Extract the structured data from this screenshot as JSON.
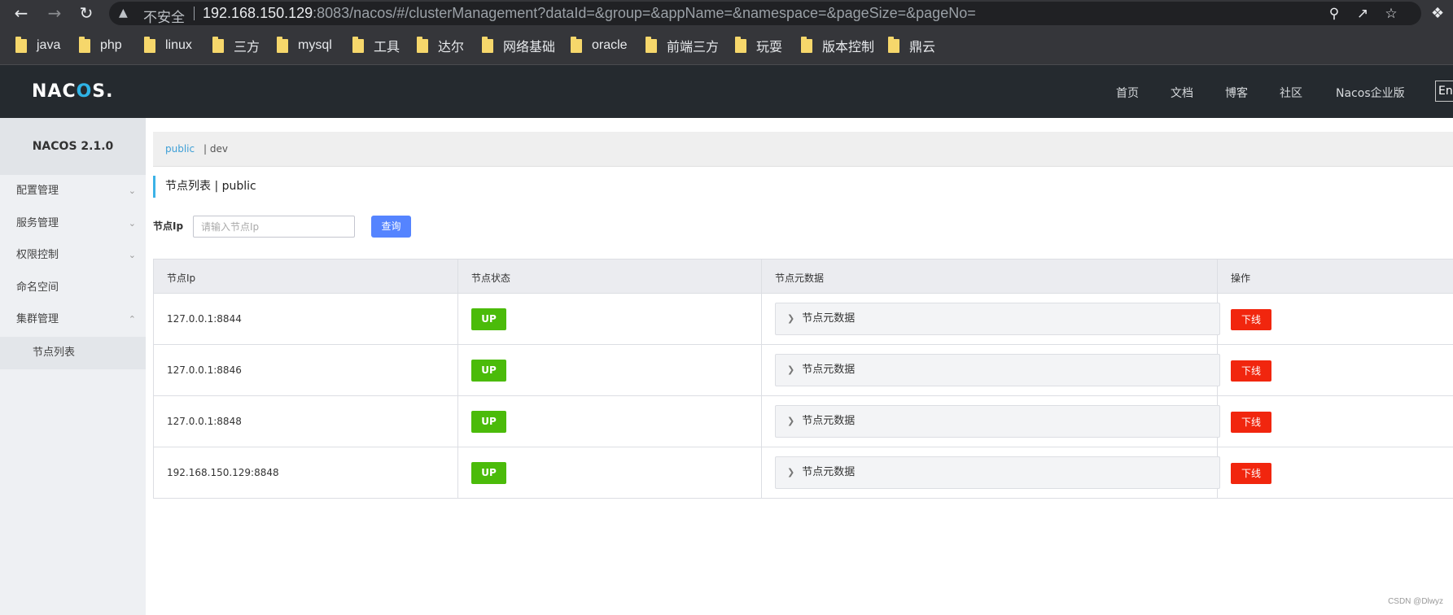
{
  "browser": {
    "insecure_label": "不安全",
    "url_host": "192.168.150.129",
    "url_rest": ":8083/nacos/#/clusterManagement?dataId=&group=&appName=&namespace=&pageSize=&pageNo=",
    "bookmarks": [
      "java",
      "php",
      "linux",
      "三方",
      "mysql",
      "工具",
      "达尔",
      "网络基础",
      "oracle",
      "前端三方",
      "玩耍",
      "版本控制",
      "鼎云"
    ]
  },
  "header": {
    "logo_main": "NAC",
    "logo_accent": "O",
    "logo_tail": "S.",
    "nav": [
      "首页",
      "文档",
      "博客",
      "社区",
      "Nacos企业版"
    ],
    "lang": "En"
  },
  "sidebar": {
    "title": "NACOS 2.1.0",
    "items": [
      "配置管理",
      "服务管理",
      "权限控制",
      "命名空间",
      "集群管理"
    ],
    "sub_item": "节点列表"
  },
  "namespaces": {
    "active": "public",
    "other": "| dev"
  },
  "page": {
    "title": "节点列表  |  public"
  },
  "filter": {
    "label": "节点Ip",
    "placeholder": "请输入节点Ip",
    "value": "",
    "query_label": "查询"
  },
  "table": {
    "headers": [
      "节点Ip",
      "节点状态",
      "节点元数据",
      "操作"
    ],
    "rows": [
      {
        "ip": "127.0.0.1:8844",
        "status": "UP",
        "meta": "节点元数据",
        "action": "下线"
      },
      {
        "ip": "127.0.0.1:8846",
        "status": "UP",
        "meta": "节点元数据",
        "action": "下线"
      },
      {
        "ip": "127.0.0.1:8848",
        "status": "UP",
        "meta": "节点元数据",
        "action": "下线"
      },
      {
        "ip": "192.168.150.129:8848",
        "status": "UP",
        "meta": "节点元数据",
        "action": "下线"
      }
    ]
  },
  "watermark": "CSDN @Dlwyz",
  "colors": {
    "accent": "#5584ff",
    "up": "#4bbb0a",
    "offline": "#f1260e",
    "header_bg": "#252a2f"
  }
}
